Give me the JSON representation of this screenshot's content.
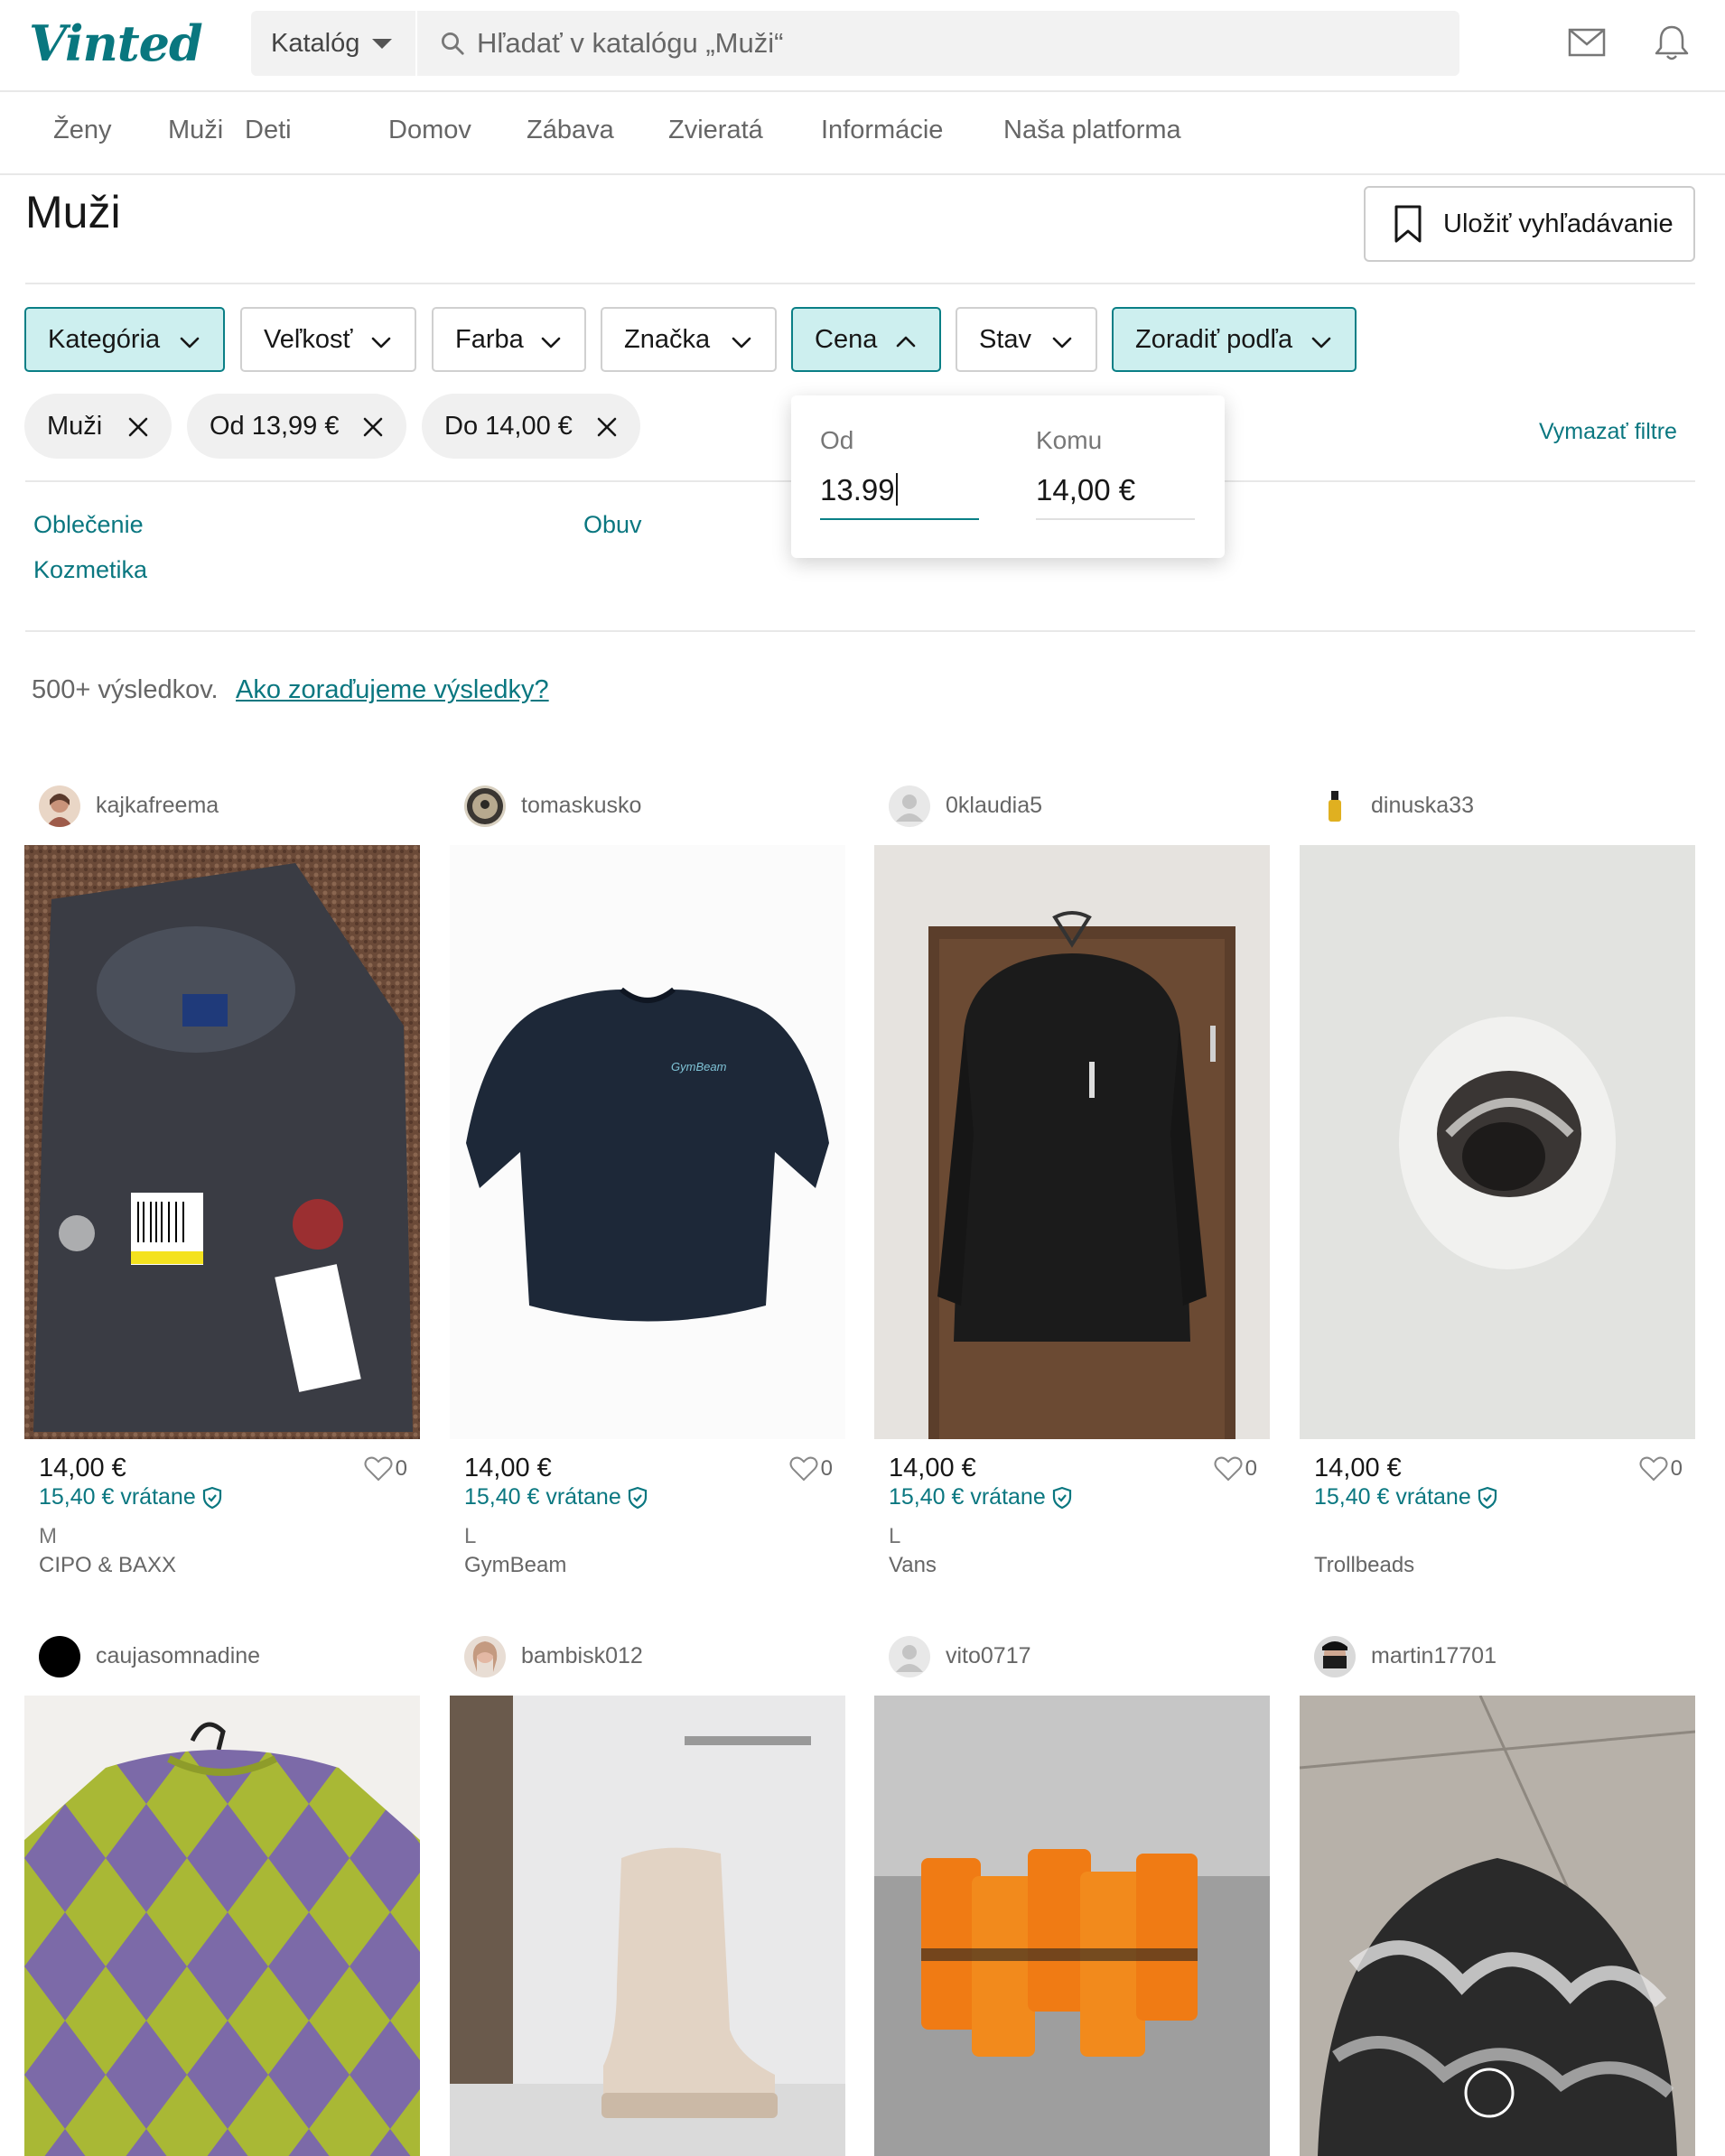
{
  "header": {
    "logo": "Vinted",
    "catalog_select": "Katalóg",
    "search_placeholder": "Hľadať v katalógu „Muži“"
  },
  "nav": [
    "Ženy",
    "Muži",
    "Deti",
    "Domov",
    "Zábava",
    "Zvieratá",
    "Informácie",
    "Naša platforma"
  ],
  "page": {
    "title": "Muži",
    "save_search": "Uložiť vyhľadávanie"
  },
  "filters": [
    "Kategória",
    "Veľkosť",
    "Farba",
    "Značka",
    "Cena",
    "Stav",
    "Zoradiť podľa"
  ],
  "chips": [
    "Muži",
    "Od 13,99 €",
    "Do 14,00 €"
  ],
  "clear_filters": "Vymazať filtre",
  "price_popup": {
    "from_label": "Od",
    "from_value": "13.99",
    "to_label": "Komu",
    "to_value": "14,00 €"
  },
  "subcategories": [
    "Oblečenie",
    "Obuv",
    "Kozmetika"
  ],
  "results": {
    "count": "500+ výsledkov.",
    "link": "Ako zoraďujeme výsledky?"
  },
  "items": [
    {
      "user": "kajkafreema",
      "price": "14,00 €",
      "price_incl": "15,40 € vrátane",
      "likes": "0",
      "size": "M",
      "brand": "CIPO & BAXX"
    },
    {
      "user": "tomaskusko",
      "price": "14,00 €",
      "price_incl": "15,40 € vrátane",
      "likes": "0",
      "size": "L",
      "brand": "GymBeam"
    },
    {
      "user": "0klaudia5",
      "price": "14,00 €",
      "price_incl": "15,40 € vrátane",
      "likes": "0",
      "size": "L",
      "brand": "Vans"
    },
    {
      "user": "dinuska33",
      "price": "14,00 €",
      "price_incl": "15,40 € vrátane",
      "likes": "0",
      "size": "",
      "brand": "Trollbeads"
    },
    {
      "user": "caujasomnadine"
    },
    {
      "user": "bambisk012"
    },
    {
      "user": "vito0717"
    },
    {
      "user": "martin17701"
    }
  ],
  "colors": {
    "accent": "#09777f",
    "active_filter_bg": "#cdefef"
  }
}
